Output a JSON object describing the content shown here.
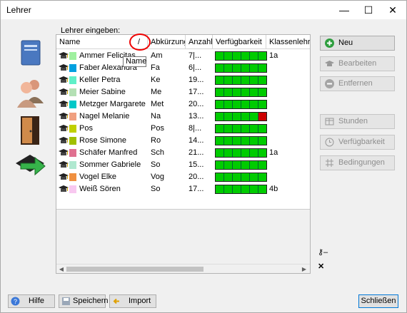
{
  "window": {
    "title": "Lehrer"
  },
  "list": {
    "label": "Lehrer eingeben:",
    "columns": [
      "Name",
      "Abkürzung",
      "Anzahl",
      "Verfügbarkeit",
      "Klassenlehrer"
    ],
    "sort_indicator": "/",
    "tooltip": "Name",
    "rows": [
      {
        "name": "Ammer Felicitas",
        "abbr": "Am",
        "count": "7|...",
        "class": "1a",
        "color": "#9ff09f"
      },
      {
        "name": "Faber Alexandra",
        "abbr": "Fa",
        "count": "6|...",
        "class": "",
        "color": "#00a0e0"
      },
      {
        "name": "Keller Petra",
        "abbr": "Ke",
        "count": "19...",
        "class": "",
        "color": "#5ff0c8"
      },
      {
        "name": "Meier Sabine",
        "abbr": "Me",
        "count": "17...",
        "class": "",
        "color": "#b4e0b4"
      },
      {
        "name": "Metzger Margarete",
        "abbr": "Met",
        "count": "20...",
        "class": "",
        "color": "#00c8c8"
      },
      {
        "name": "Nagel Melanie",
        "abbr": "Na",
        "count": "13...",
        "class": "",
        "color": "#f0a080"
      },
      {
        "name": "Pos",
        "abbr": "Pos",
        "count": "8|...",
        "class": "",
        "color": "#c0d000"
      },
      {
        "name": "Rose Simone",
        "abbr": "Ro",
        "count": "14...",
        "class": "",
        "color": "#a0c000"
      },
      {
        "name": "Schäfer Manfred",
        "abbr": "Sch",
        "count": "21...",
        "class": "1a",
        "color": "#e07090"
      },
      {
        "name": "Sommer Gabriele",
        "abbr": "So",
        "count": "15...",
        "class": "",
        "color": "#b0e8d0"
      },
      {
        "name": "Vogel Elke",
        "abbr": "Vog",
        "count": "20...",
        "class": "",
        "color": "#f09040"
      },
      {
        "name": "Weiß Sören",
        "abbr": "So",
        "count": "17...",
        "class": "4b",
        "color": "#f8c8f0"
      }
    ]
  },
  "actions": {
    "neu": "Neu",
    "bearbeiten": "Bearbeiten",
    "entfernen": "Entfernen",
    "stunden": "Stunden",
    "verfuegbarkeit": "Verfügbarkeit",
    "bedingungen": "Bedingungen"
  },
  "footer": {
    "hilfe": "Hilfe",
    "speichern": "Speichern",
    "import": "Import",
    "schliessen": "Schließen"
  },
  "colors": {
    "accent": "#0078d7",
    "available": "#00cc00",
    "unavailable": "#cc0000"
  }
}
